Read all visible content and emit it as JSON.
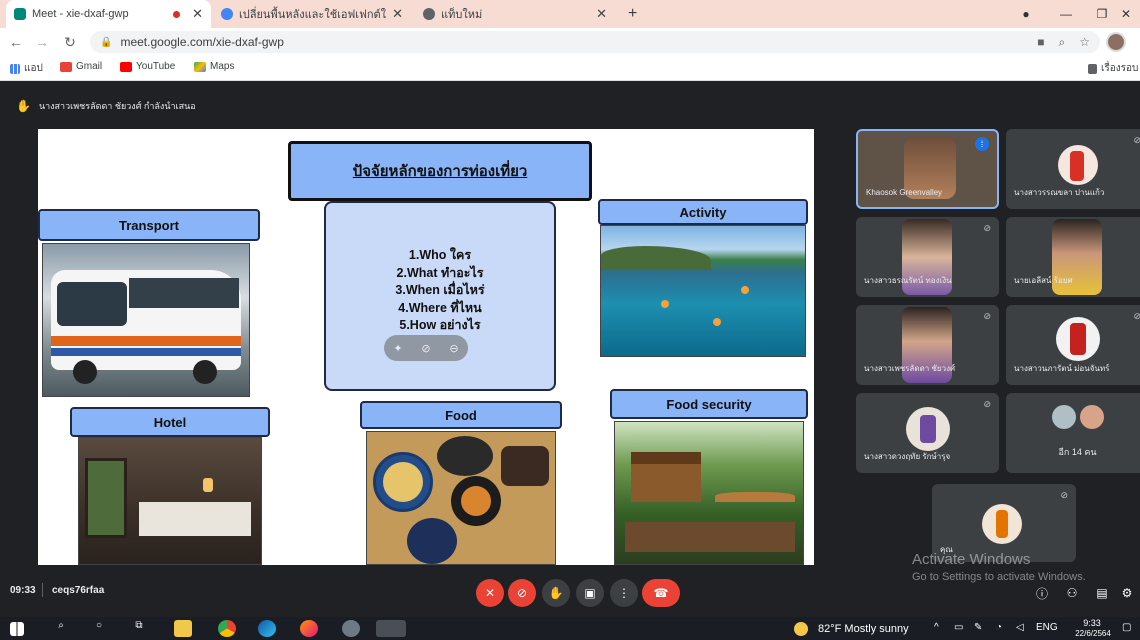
{
  "browser": {
    "tabs": [
      {
        "title": "Meet - xie-dxaf-gwp",
        "active": true
      },
      {
        "title": "เปลี่ยนพื้นหลังและใช้เอฟเฟกต์ใน Goo",
        "active": false
      },
      {
        "title": "แท็บใหม่",
        "active": false
      }
    ],
    "new_tab_label": "+",
    "url": "meet.google.com/xie-dxaf-gwp",
    "bookmarks": [
      "แอป",
      "Gmail",
      "YouTube",
      "Maps"
    ],
    "reading_list": "เรื่องรอบ"
  },
  "meet": {
    "presenter_label": "นางสาวเพชรลัดดา ชัยวงศ์ กำลังนำเสนอ",
    "time": "09:33",
    "meeting_code": "ceqs76rfaa",
    "watermark_title": "Activate Windows",
    "watermark_sub": "Go to Settings to activate Windows.",
    "more_count": "อีก 14 คน",
    "self_label": "คุณ",
    "participants": [
      "Khaosok Greenvalley",
      "นางสาวรรณขลา ปานแก้ว",
      "นางสาวธรณรัตน์ ทองเงิน",
      "นายเอลีสน์ ร้อยศ",
      "นางสาวเพชรลัดดา ชัยวงศ์",
      "นางสาวนภารัตน์ ม่อนจันทร์",
      "นางสาวดวงฤทัย รักษ์ารุจ"
    ]
  },
  "slide": {
    "title": "ปัจจัยหลักของการท่องเที่ยว",
    "labels": {
      "transport": "Transport",
      "activity": "Activity",
      "hotel": "Hotel",
      "food": "Food",
      "food_security": "Food security"
    },
    "questions": [
      "1.Who ใคร",
      "2.What ทำอะไร",
      "3.When เมื่อไหร่",
      "4.Where ที่ไหน",
      "5.How อย่างไร"
    ]
  },
  "taskbar": {
    "weather": "82°F  Mostly sunny",
    "lang": "ENG",
    "clock": "9:33",
    "date": "22/6/2564"
  },
  "colors": {
    "label_blue": "#8ab4f8",
    "meet_bg": "#202124",
    "end_call": "#ea4335"
  }
}
